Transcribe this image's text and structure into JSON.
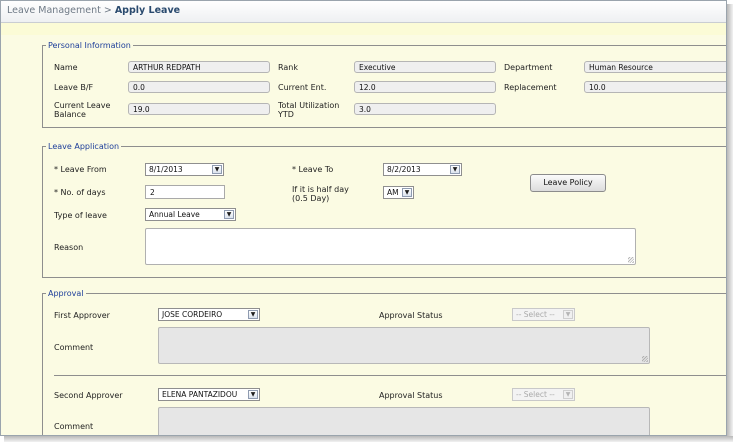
{
  "breadcrumb": {
    "parent": "Leave Management",
    "separator": ">",
    "current": "Apply Leave"
  },
  "personal": {
    "legend": "Personal Information",
    "name_label": "Name",
    "name_value": "ARTHUR REDPATH",
    "rank_label": "Rank",
    "rank_value": "Executive",
    "department_label": "Department",
    "department_value": "Human Resource",
    "leave_bf_label": "Leave B/F",
    "leave_bf_value": "0.0",
    "current_ent_label": "Current Ent.",
    "current_ent_value": "12.0",
    "replacement_label": "Replacement",
    "replacement_value": "10.0",
    "current_balance_label_1": "Current Leave",
    "current_balance_label_2": "Balance",
    "current_balance_value": "19.0",
    "total_util_label_1": "Total Utilization",
    "total_util_label_2": "YTD",
    "total_util_value": "3.0"
  },
  "application": {
    "legend": "Leave Application",
    "leave_from_label": "* Leave From",
    "leave_from_value": "8/1/2013",
    "leave_to_label": "* Leave To",
    "leave_to_value": "8/2/2013",
    "num_days_label": "* No. of days",
    "num_days_value": "2",
    "half_day_label_1": "If it is half day",
    "half_day_label_2": "(0.5 Day)",
    "half_day_value": "AM",
    "type_label": "Type of leave",
    "type_value": "Annual Leave",
    "reason_label": "Reason",
    "leave_policy_button": "Leave Policy"
  },
  "approval": {
    "legend": "Approval",
    "first_approver_label": "First Approver",
    "first_approver_value": "JOSE CORDEIRO",
    "status_label": "Approval Status",
    "status_placeholder": "-- Select --",
    "comment_label": "Comment",
    "second_approver_label": "Second Approver",
    "second_approver_value": "ELENA PANTAZIDOU"
  },
  "icons": {
    "dropdown_arrow": "▼"
  }
}
